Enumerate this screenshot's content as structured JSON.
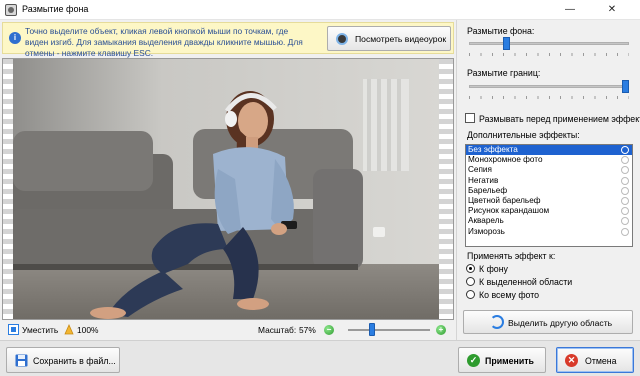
{
  "window": {
    "title": "Размытие фона",
    "minimize_glyph": "—",
    "close_glyph": "✕"
  },
  "infobar": {
    "icon": "i",
    "text": "Точно выделите объект, кликая левой кнопкой мыши по точкам, где виден изгиб. Для замыкания выделения дважды кликните мышью. Для отмены - нажмите клавишу ESC.",
    "video_button_label": "Посмотреть видеоурок"
  },
  "statusbar": {
    "fit_label": "Уместить",
    "actual_size_label": "100%",
    "zoom_label": "Масштаб:",
    "zoom_value": "57%",
    "zoom_out_glyph": "−",
    "zoom_in_glyph": "+"
  },
  "right_panel": {
    "blur_bg_label": "Размытие фона:",
    "blur_bg_level": 0.22,
    "blur_edges_label": "Размытие границ:",
    "blur_edges_level": 1.0,
    "blur_before_effect_label": "Размывать перед применением эффекта",
    "blur_before_effect_checked": false,
    "extra_effects_label": "Дополнительные эффекты:",
    "effects": [
      "Без эффекта",
      "Монохромное фото",
      "Сепия",
      "Негатив",
      "Барельеф",
      "Цветной барельеф",
      "Рисунок карандашом",
      "Акварель",
      "Изморозь"
    ],
    "selected_effect_index": 0,
    "apply_to_label": "Применять эффект к:",
    "apply_to_options": [
      "К фону",
      "К выделенной области",
      "Ко всему фото"
    ],
    "apply_to_selected_index": 0,
    "select_other_area_label": "Выделить другую область"
  },
  "bottom": {
    "save_label": "Сохранить в файл...",
    "apply_label": "Применить",
    "cancel_label": "Отмена"
  },
  "colors": {
    "accent": "#2a7de1",
    "selection": "#1e62d0",
    "info_bg": "#fdf7c6",
    "info_text": "#2a4f94",
    "apply_icon": "#2e9b2e",
    "cancel_icon": "#d83a2a"
  }
}
